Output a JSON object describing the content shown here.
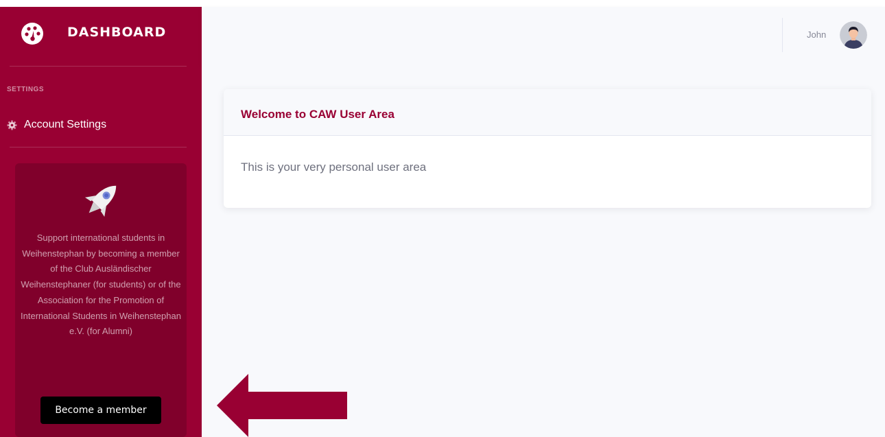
{
  "brand": {
    "title": "DASHBOARD"
  },
  "sidebar": {
    "section_heading": "SETTINGS",
    "items": [
      {
        "label": "Account Settings",
        "icon": "gear-icon"
      }
    ],
    "promo": {
      "icon": "rocket-icon",
      "text": "Support international students in Weihenstephan by becoming a member of the Club Ausländischer Weihenstephaner (for students) or of the Association for the Promotion of International Students in Weihenstephan e.V. (for Alumni)",
      "button_label": "Become a member"
    }
  },
  "topbar": {
    "user_name": "John",
    "avatar_icon": "user-avatar"
  },
  "main": {
    "card": {
      "title": "Welcome to CAW User Area",
      "body": "This is your very personal user area"
    }
  },
  "annotation": {
    "icon": "arrow-left-icon"
  },
  "colors": {
    "brand": "#990033",
    "promo_bg": "#80002b",
    "content_bg": "#f8f9fc",
    "button_bg": "#000000"
  }
}
